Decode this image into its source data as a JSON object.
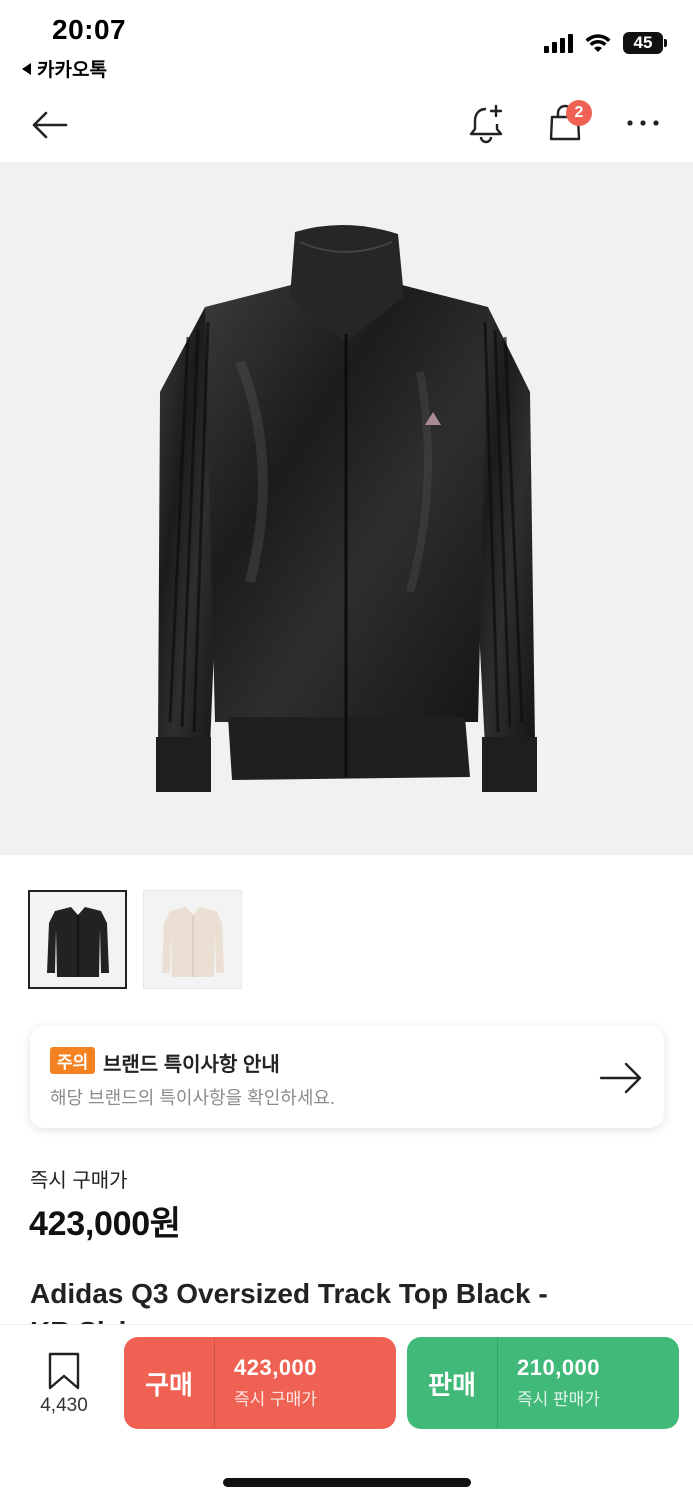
{
  "status_bar": {
    "time": "20:07",
    "back_app": "카카오톡",
    "battery": "45"
  },
  "header": {
    "icons": [
      "back-arrow-icon",
      "bell-plus-icon",
      "shopping-bag-icon",
      "more-icon"
    ],
    "cart_count": "2"
  },
  "notice": {
    "badge": "주의",
    "title": "브랜드 특이사항 안내",
    "description": "해당 브랜드의 특이사항을 확인하세요."
  },
  "price": {
    "label": "즉시 구매가",
    "value": "423,000원"
  },
  "product": {
    "name_line1": "Adidas Q3 Oversized Track Top Black -",
    "name_line2": "KR Sizing"
  },
  "bottom_bar": {
    "wish_count": "4,430",
    "buy": {
      "label": "구매",
      "price": "423,000",
      "sub": "즉시 구매가"
    },
    "sell": {
      "label": "판매",
      "price": "210,000",
      "sub": "즉시 판매가"
    }
  },
  "colors": {
    "buy": "#ef6253",
    "sell": "#41b979",
    "notice_badge": "#f58220",
    "cart_badge": "#ef6253"
  }
}
